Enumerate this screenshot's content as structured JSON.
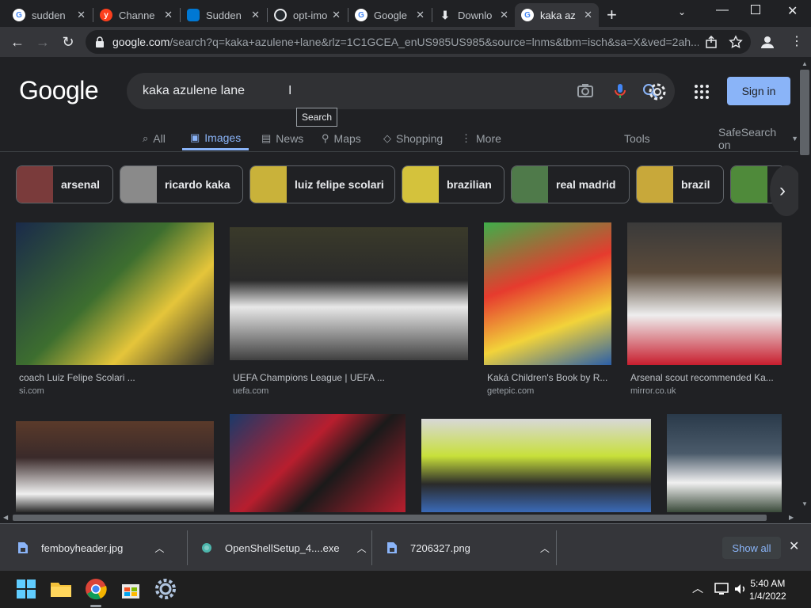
{
  "browser": {
    "tabs": [
      {
        "title": "sudden",
        "icon": "google-icon",
        "color": "#4285f4"
      },
      {
        "title": "Channe",
        "icon": "yandex-icon",
        "color": "#fc3f1d"
      },
      {
        "title": "Sudden",
        "icon": "onedrive-icon",
        "color": "#0078d4"
      },
      {
        "title": "opt-imo",
        "icon": "github-icon",
        "color": "#24292e"
      },
      {
        "title": "Google",
        "icon": "google-icon",
        "color": "#4285f4"
      },
      {
        "title": "Downlo",
        "icon": "download-icon",
        "color": "#5f6368"
      },
      {
        "title": "kaka az",
        "icon": "google-icon",
        "color": "#4285f4",
        "active": true
      }
    ],
    "url_host": "google.com",
    "url_path": "/search?q=kaka+azulene+lane&rlz=1C1GCEA_enUS985US985&source=lnms&tbm=isch&sa=X&ved=2ah..."
  },
  "google": {
    "logo": "Google",
    "query": "kaka azulene lane",
    "tooltip": "Search",
    "signin": "Sign in",
    "tabs": [
      {
        "label": "All",
        "icon": "search-icon"
      },
      {
        "label": "Images",
        "icon": "image-icon",
        "active": true
      },
      {
        "label": "News",
        "icon": "news-icon"
      },
      {
        "label": "Maps",
        "icon": "map-pin-icon"
      },
      {
        "label": "Shopping",
        "icon": "tag-icon"
      },
      {
        "label": "More",
        "icon": "more-vert-icon"
      }
    ],
    "tools": "Tools",
    "safesearch": "SafeSearch on",
    "chips": [
      {
        "label": "arsenal",
        "color": "#7a3b3b"
      },
      {
        "label": "ricardo kaka",
        "color": "#8a8a8a"
      },
      {
        "label": "luiz felipe scolari",
        "color": "#c9b23a"
      },
      {
        "label": "brazilian",
        "color": "#d4c23c"
      },
      {
        "label": "real madrid",
        "color": "#4f7a4a"
      },
      {
        "label": "brazil",
        "color": "#c8a83a"
      },
      {
        "label": "",
        "color": "#4f8a3a"
      }
    ],
    "results": [
      {
        "caption": "coach Luiz Felipe Scolari ...",
        "source": "si.com",
        "colors": [
          "#3d6e2f",
          "#e5c53a"
        ]
      },
      {
        "caption": "UEFA Champions League | UEFA ...",
        "source": "uefa.com",
        "colors": [
          "#2a2a2a",
          "#e8e8e8"
        ]
      },
      {
        "caption": "Kaká Children's Book by R...",
        "source": "getepic.com",
        "colors": [
          "#3fae4a",
          "#e63b2e"
        ]
      },
      {
        "caption": "Arsenal scout recommended Ka...",
        "source": "mirror.co.uk",
        "colors": [
          "#3a3a3a",
          "#eeeeee"
        ]
      },
      {
        "caption": "",
        "source": "",
        "colors": [
          "#5a3a2a",
          "#f0f0f0"
        ]
      },
      {
        "caption": "",
        "source": "",
        "colors": [
          "#1a3a6a",
          "#b81e2e"
        ]
      },
      {
        "caption": "",
        "source": "",
        "colors": [
          "#d8d8d8",
          "#c8e03a"
        ]
      },
      {
        "caption": "",
        "source": "",
        "colors": [
          "#2a3a4a",
          "#f0f0f0"
        ]
      }
    ]
  },
  "downloads": {
    "items": [
      {
        "name": "femboyheader.jpg",
        "icon": "file-icon"
      },
      {
        "name": "OpenShellSetup_4....exe",
        "icon": "shell-icon"
      },
      {
        "name": "7206327.png",
        "icon": "file-icon"
      }
    ],
    "show_all": "Show all"
  },
  "taskbar": {
    "time": "5:40 AM",
    "date": "1/4/2022"
  }
}
